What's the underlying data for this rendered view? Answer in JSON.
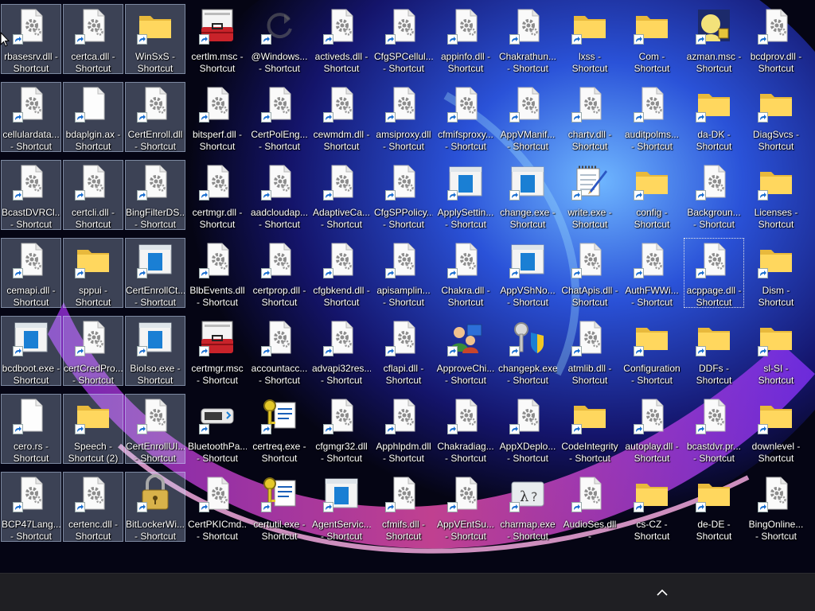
{
  "desktop": {
    "icons": [
      {
        "label": "rbasesrv.dll -\nShortcut",
        "icon": "gear-dll-icon"
      },
      {
        "label": "certca.dll -\nShortcut",
        "icon": "gear-dll-icon"
      },
      {
        "label": "WinSxS -\nShortcut",
        "icon": "folder-icon"
      },
      {
        "label": "certlm.msc -\nShortcut",
        "icon": "toolbox-icon"
      },
      {
        "label": "@Windows...\n- Shortcut",
        "icon": "refresh-icon"
      },
      {
        "label": "activeds.dll -\nShortcut",
        "icon": "gear-dll-icon"
      },
      {
        "label": "CfgSPCellul...\n- Shortcut",
        "icon": "gear-dll-icon"
      },
      {
        "label": "appinfo.dll -\nShortcut",
        "icon": "gear-dll-icon"
      },
      {
        "label": "Chakrathun...\n- Shortcut",
        "icon": "gear-dll-icon"
      },
      {
        "label": "lxss -\nShortcut",
        "icon": "folder-icon"
      },
      {
        "label": "Com -\nShortcut",
        "icon": "folder-icon"
      },
      {
        "label": "azman.msc -\nShortcut",
        "icon": "azman-icon"
      },
      {
        "label": "bcdprov.dll -\nShortcut",
        "icon": "gear-dll-icon"
      },
      {
        "label": "cellulardata...\n- Shortcut",
        "icon": "gear-dll-icon"
      },
      {
        "label": "bdaplgin.ax -\nShortcut",
        "icon": "blank-file-icon"
      },
      {
        "label": "CertEnroll.dll\n- Shortcut",
        "icon": "gear-dll-icon"
      },
      {
        "label": "bitsperf.dll -\nShortcut",
        "icon": "gear-dll-icon"
      },
      {
        "label": "CertPolEng...\n- Shortcut",
        "icon": "gear-dll-icon"
      },
      {
        "label": "cewmdm.dll -\nShortcut",
        "icon": "gear-dll-icon"
      },
      {
        "label": "amsiproxy.dll\n- Shortcut",
        "icon": "gear-dll-icon"
      },
      {
        "label": "cfmifsproxy...\n- Shortcut",
        "icon": "gear-dll-icon"
      },
      {
        "label": "AppVManif...\n- Shortcut",
        "icon": "gear-dll-icon"
      },
      {
        "label": "chartv.dll -\nShortcut",
        "icon": "gear-dll-icon"
      },
      {
        "label": "auditpolms...\n- Shortcut",
        "icon": "gear-dll-icon"
      },
      {
        "label": "da-DK -\nShortcut",
        "icon": "folder-icon"
      },
      {
        "label": "DiagSvcs -\nShortcut",
        "icon": "folder-icon"
      },
      {
        "label": "BcastDVRCl...\n- Shortcut",
        "icon": "gear-dll-icon"
      },
      {
        "label": "certcli.dll -\nShortcut",
        "icon": "gear-dll-icon"
      },
      {
        "label": "BingFilterDS...\n- Shortcut",
        "icon": "gear-dll-icon"
      },
      {
        "label": "certmgr.dll -\nShortcut",
        "icon": "gear-dll-icon"
      },
      {
        "label": "aadcloudap...\n- Shortcut",
        "icon": "gear-dll-icon"
      },
      {
        "label": "AdaptiveCa...\n- Shortcut",
        "icon": "gear-dll-icon"
      },
      {
        "label": "CfgSPPolicy...\n- Shortcut",
        "icon": "gear-dll-icon"
      },
      {
        "label": "ApplySettin...\n- Shortcut",
        "icon": "window-app-icon"
      },
      {
        "label": "change.exe -\nShortcut",
        "icon": "window-app-icon"
      },
      {
        "label": "write.exe -\nShortcut",
        "icon": "notepad-pen-icon"
      },
      {
        "label": "config -\nShortcut",
        "icon": "folder-icon"
      },
      {
        "label": "Backgroun...\n- Shortcut",
        "icon": "gear-dll-icon"
      },
      {
        "label": "Licenses -\nShortcut",
        "icon": "folder-icon"
      },
      {
        "label": "cemapi.dll -\nShortcut",
        "icon": "gear-dll-icon"
      },
      {
        "label": "sppui -\nShortcut",
        "icon": "folder-icon"
      },
      {
        "label": "CertEnrollCt...\n- Shortcut",
        "icon": "window-app-icon"
      },
      {
        "label": "BlbEvents.dll\n- Shortcut",
        "icon": "gear-dll-icon"
      },
      {
        "label": "certprop.dll -\nShortcut",
        "icon": "gear-dll-icon"
      },
      {
        "label": "cfgbkend.dll -\nShortcut",
        "icon": "gear-dll-icon"
      },
      {
        "label": "apisamplin...\n- Shortcut",
        "icon": "gear-dll-icon"
      },
      {
        "label": "Chakra.dll -\nShortcut",
        "icon": "gear-dll-icon"
      },
      {
        "label": "AppVShNo...\n- Shortcut",
        "icon": "window-app-icon"
      },
      {
        "label": "ChatApis.dll -\nShortcut",
        "icon": "gear-dll-icon"
      },
      {
        "label": "AuthFWWi...\n- Shortcut",
        "icon": "gear-dll-icon"
      },
      {
        "label": "acppage.dll -\nShortcut",
        "icon": "gear-dll-icon"
      },
      {
        "label": "Dism -\nShortcut",
        "icon": "folder-icon"
      },
      {
        "label": "bcdboot.exe -\nShortcut",
        "icon": "window-app-icon"
      },
      {
        "label": "certCredPro...\n- Shortcut",
        "icon": "gear-dll-icon"
      },
      {
        "label": "BioIso.exe -\nShortcut",
        "icon": "window-app-icon"
      },
      {
        "label": "certmgr.msc\n- Shortcut",
        "icon": "toolbox-icon"
      },
      {
        "label": "accountacc...\n- Shortcut",
        "icon": "gear-dll-icon"
      },
      {
        "label": "advapi32res...\n- Shortcut",
        "icon": "gear-dll-icon"
      },
      {
        "label": "cflapi.dll -\nShortcut",
        "icon": "gear-dll-icon"
      },
      {
        "label": "ApproveChi...\n- Shortcut",
        "icon": "users-icon"
      },
      {
        "label": "changepk.exe\n- Shortcut",
        "icon": "key-shield-icon"
      },
      {
        "label": "atmlib.dll -\nShortcut",
        "icon": "gear-dll-icon"
      },
      {
        "label": "Configuration\n- Shortcut",
        "icon": "folder-icon"
      },
      {
        "label": "DDFs -\nShortcut",
        "icon": "folder-icon"
      },
      {
        "label": "sl-SI -\nShortcut",
        "icon": "folder-icon"
      },
      {
        "label": "cero.rs -\nShortcut",
        "icon": "blank-file-icon"
      },
      {
        "label": "Speech -\nShortcut (2)",
        "icon": "folder-icon"
      },
      {
        "label": "CertEnrollUI...\n- Shortcut",
        "icon": "gear-dll-icon"
      },
      {
        "label": "BluetoothPa...\n- Shortcut",
        "icon": "bluetooth-device-icon"
      },
      {
        "label": "certreq.exe -\nShortcut",
        "icon": "cert-keys-icon"
      },
      {
        "label": "cfgmgr32.dll\n- Shortcut",
        "icon": "gear-dll-icon"
      },
      {
        "label": "Apphlpdm.dll\n- Shortcut",
        "icon": "gear-dll-icon"
      },
      {
        "label": "Chakradiag...\n- Shortcut",
        "icon": "gear-dll-icon"
      },
      {
        "label": "AppXDeplo...\n- Shortcut",
        "icon": "gear-dll-icon"
      },
      {
        "label": "CodeIntegrity\n- Shortcut",
        "icon": "folder-icon"
      },
      {
        "label": "autoplay.dll -\nShortcut",
        "icon": "gear-dll-icon"
      },
      {
        "label": "bcastdvr.pr...\n- Shortcut",
        "icon": "gear-dll-icon"
      },
      {
        "label": "downlevel -\nShortcut",
        "icon": "folder-icon"
      },
      {
        "label": "BCP47Lang...\n- Shortcut",
        "icon": "gear-dll-icon"
      },
      {
        "label": "certenc.dll -\nShortcut",
        "icon": "gear-dll-icon"
      },
      {
        "label": "BitLockerWi...\n- Shortcut",
        "icon": "bitlocker-icon"
      },
      {
        "label": "CertPKICmd...\n- Shortcut",
        "icon": "gear-dll-icon"
      },
      {
        "label": "certutil.exe -\nShortcut",
        "icon": "cert-keys-icon"
      },
      {
        "label": "AgentServic...\n- Shortcut",
        "icon": "window-app-icon"
      },
      {
        "label": "cfmifs.dll -\nShortcut",
        "icon": "gear-dll-icon"
      },
      {
        "label": "AppVEntSu...\n- Shortcut",
        "icon": "gear-dll-icon"
      },
      {
        "label": "charmap.exe\n- Shortcut",
        "icon": "charmap-icon"
      },
      {
        "label": "AudioSes.dll -\nShortcut",
        "icon": "gear-dll-icon"
      },
      {
        "label": "cs-CZ -\nShortcut",
        "icon": "folder-icon"
      },
      {
        "label": "de-DE -\nShortcut",
        "icon": "folder-icon"
      },
      {
        "label": "BingOnline...\n- Shortcut",
        "icon": "gear-dll-icon"
      }
    ]
  },
  "taskbar": {
    "chevron_icon": "chevron-up-icon"
  },
  "colors": {
    "selection": "#cde1ff",
    "taskbar": "#1f1f23",
    "folder": "#ffd75e",
    "accent": "#0078d4"
  }
}
